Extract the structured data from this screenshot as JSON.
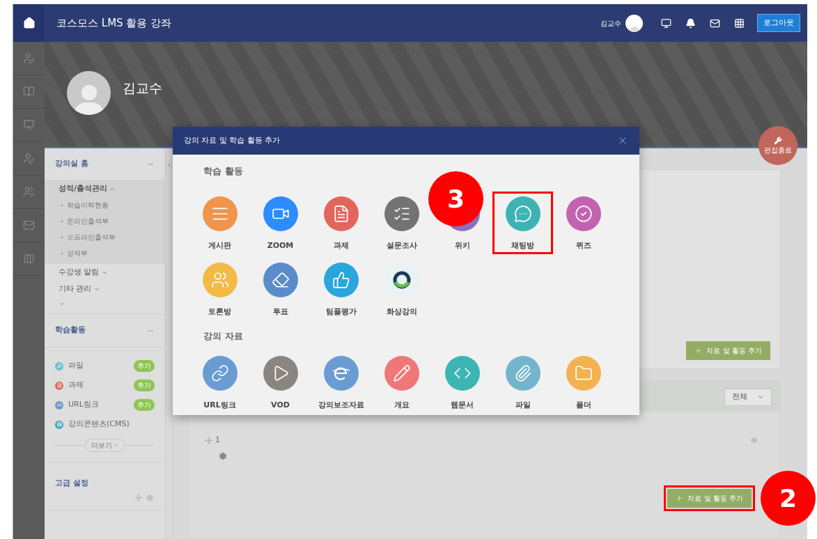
{
  "header": {
    "title": "코스모스 LMS 활용 강좌",
    "user": "김교수",
    "logout": "로그아웃"
  },
  "banner": {
    "name": "김교수",
    "edit_button": "편집종료"
  },
  "sidebar": {
    "home": {
      "title": "강의실 홈",
      "groups": [
        {
          "label": "성적/출석관리",
          "expanded": true,
          "children": [
            {
              "label": "학습이력현황"
            },
            {
              "label": "온라인출석부"
            },
            {
              "label": "오프라인출석부"
            },
            {
              "label": "성적부"
            }
          ]
        },
        {
          "label": "수강생 알림",
          "expanded": false
        },
        {
          "label": "기타 관리",
          "expanded": false
        }
      ]
    },
    "activities": {
      "title": "학습활동",
      "items": [
        {
          "label": "파일",
          "color": "#6cbfd0",
          "add": "추가"
        },
        {
          "label": "과제",
          "color": "#e06a5f",
          "add": "추가"
        },
        {
          "label": "URL링크",
          "color": "#6f97cf",
          "add": "추가"
        },
        {
          "label": "강의콘텐츠(CMS)",
          "color": "#3ba9b5"
        }
      ],
      "more": "더보기"
    },
    "advanced": {
      "title": "고급 설정"
    }
  },
  "main": {
    "add_button_top": "자료 및 활동 추가",
    "filter": "전체",
    "section_number": "1",
    "add_button": {
      "label": "자료 및 활동 추가",
      "highlighted": true
    }
  },
  "modal": {
    "title": "강의 자료 및 학습 활동 추가",
    "groups": [
      {
        "heading": "학습 활동",
        "items": [
          {
            "label": "게시판",
            "color": "#f0954b",
            "highlighted": false
          },
          {
            "label": "ZOOM",
            "color": "#2d8cff",
            "highlighted": false
          },
          {
            "label": "과제",
            "color": "#e2665c",
            "highlighted": false
          },
          {
            "label": "설문조사",
            "color": "#737373",
            "highlighted": false
          },
          {
            "label": "위키",
            "color": "#8a6fbf",
            "highlighted": false
          },
          {
            "label": "채팅방",
            "color": "#3fb3b3",
            "highlighted": true
          },
          {
            "label": "퀴즈",
            "color": "#c262b0",
            "highlighted": false
          },
          {
            "label": "토론방",
            "color": "#f2bb48",
            "highlighted": false
          },
          {
            "label": "투표",
            "color": "#5a8ccc",
            "highlighted": false
          },
          {
            "label": "팀플평가",
            "color": "#2aa6dc",
            "highlighted": false
          },
          {
            "label": "화상강의",
            "color": "#e8f3f5",
            "highlighted": false
          }
        ]
      },
      {
        "heading": "강의 자료",
        "items": [
          {
            "label": "URL링크",
            "color": "#6a9bd2",
            "highlighted": false
          },
          {
            "label": "VOD",
            "color": "#8a8580",
            "highlighted": false
          },
          {
            "label": "강의보조자료",
            "color": "#6a9bd2",
            "highlighted": false
          },
          {
            "label": "개요",
            "color": "#ef7876",
            "highlighted": false
          },
          {
            "label": "웹문서",
            "color": "#3db5b5",
            "highlighted": false
          },
          {
            "label": "파일",
            "color": "#74b4cc",
            "highlighted": false
          },
          {
            "label": "폴더",
            "color": "#f3b24f",
            "highlighted": false
          }
        ]
      }
    ]
  },
  "annotations": [
    {
      "label": "3"
    },
    {
      "label": "2"
    }
  ]
}
